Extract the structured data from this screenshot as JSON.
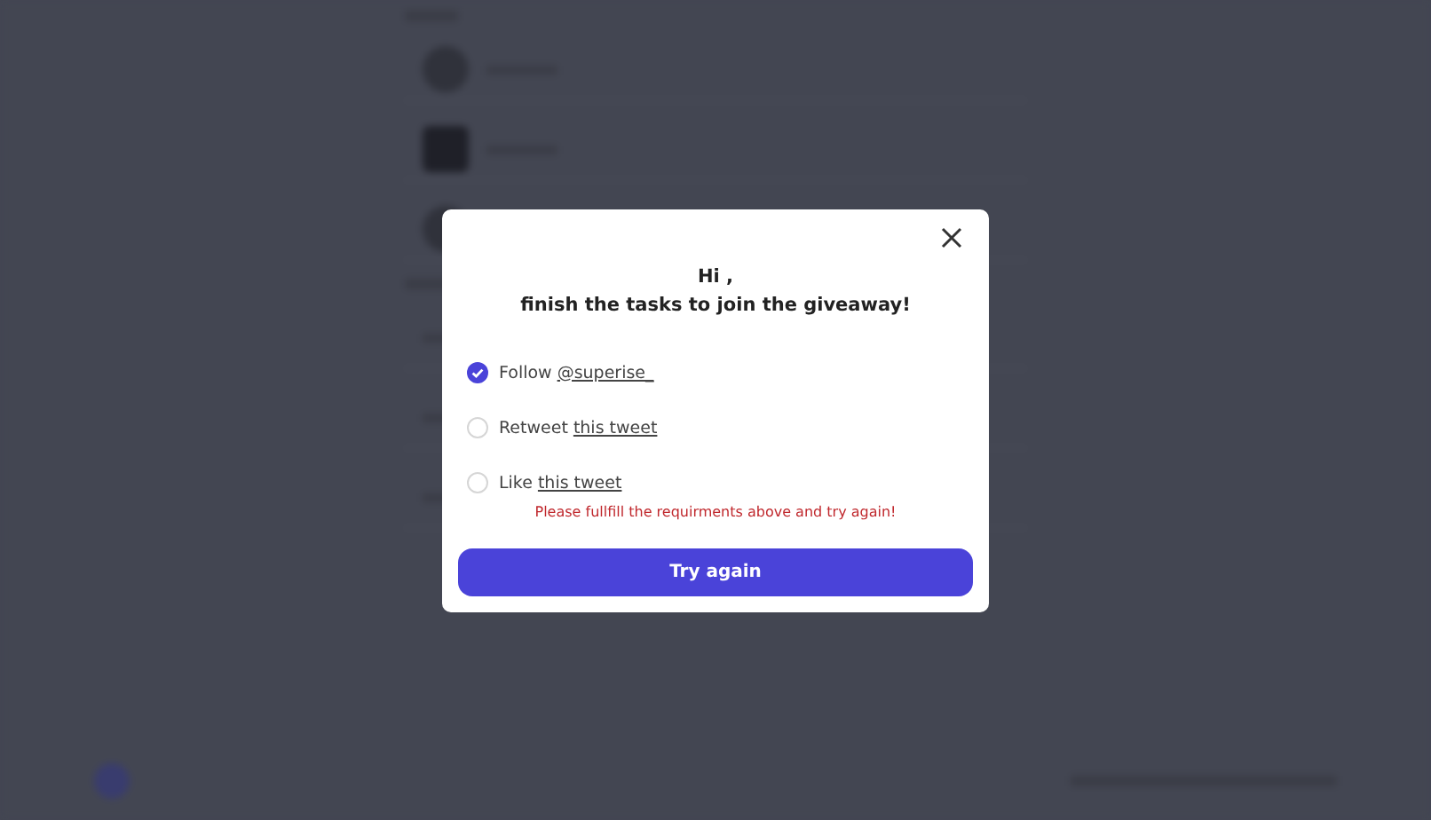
{
  "modal": {
    "greeting": "Hi ,",
    "subtitle": "finish the tasks to join the giveaway!",
    "tasks": [
      {
        "label": "Follow",
        "link": "@superise_",
        "checked": true
      },
      {
        "label": "Retweet",
        "link": "this tweet",
        "checked": false
      },
      {
        "label": "Like",
        "link": "this tweet",
        "checked": false
      }
    ],
    "error": "Please fullfill the requirments above and try again!",
    "button": "Try again"
  }
}
